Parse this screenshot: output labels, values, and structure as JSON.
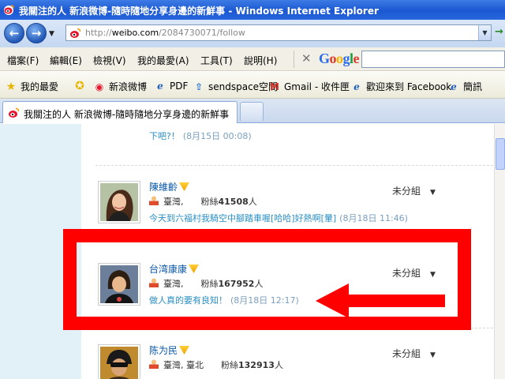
{
  "window": {
    "title": "我關注的人 新浪微博-隨時隨地分享身邊的新鮮事 - Windows Internet Explorer"
  },
  "address_bar": {
    "url_prefix": "http://",
    "url_domain": "weibo.com",
    "url_path": "/2084730071/follow"
  },
  "menu": {
    "items": [
      "檔案(F)",
      "編輯(E)",
      "檢視(V)",
      "我的最愛(A)",
      "工具(T)",
      "說明(H)"
    ]
  },
  "google_toolbar": {
    "logo_text": "Google",
    "logo_colors": [
      "#2b6ce8",
      "#e23a2a",
      "#f4b400",
      "#2b6ce8",
      "#1a9e3a",
      "#e23a2a"
    ]
  },
  "favorites": {
    "main_label": "我的最愛",
    "items": [
      "新浪微博",
      "PDF",
      "sendspace空間",
      "Gmail - 收件匣",
      "歡迎來到 Facebook",
      "簡訊"
    ]
  },
  "tab": {
    "label": "我關注的人 新浪微博-隨時隨地分享身邊的新鮮事"
  },
  "follow_list": {
    "top_partial": {
      "status": "下吧?！",
      "time": "(8月15日 00:08)"
    },
    "items": [
      {
        "name": "陳維齡",
        "location": "臺灣,",
        "fans_label": "粉絲",
        "fans_count": "41508",
        "fans_unit": "人",
        "status": "今天到六福村我騎空中腳踏車喔[哈哈]好熱啊[暈]",
        "time": "(8月18日 11:46)",
        "group": "未分組"
      },
      {
        "name": "台湾康康",
        "location": "臺灣,",
        "fans_label": "粉絲",
        "fans_count": "167952",
        "fans_unit": "人",
        "status": "做人真的要有良知！",
        "time": "(8月18日 12:17)",
        "group": "未分組"
      },
      {
        "name": "陈为民",
        "location": "臺灣, 臺北",
        "fans_label": "粉絲",
        "fans_count": "132913",
        "fans_unit": "人",
        "status": "",
        "time": "",
        "group": "未分組"
      }
    ]
  },
  "colors": {
    "highlight_box": "#ff0000",
    "link_blue": "#0a57a8",
    "status_blue": "#2a8fc4",
    "sidebar_bg": "#e2f1f8"
  }
}
